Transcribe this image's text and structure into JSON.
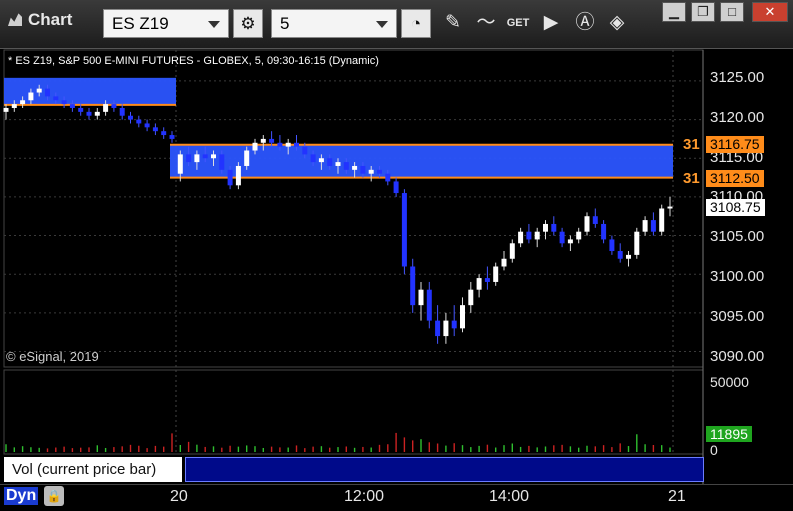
{
  "app": {
    "title": "Chart",
    "icon": "chart-icon"
  },
  "toolbar": {
    "symbol": "ES Z19",
    "interval": "5",
    "icons": [
      "settings-icon",
      "clock-icon",
      "pencil-draw-icon",
      "study-icon",
      "get-data-icon",
      "play-icon",
      "alert-icon",
      "fill-tool-icon"
    ],
    "get_label": "GET"
  },
  "window_controls": {
    "icons": [
      "minimize-icon",
      "restore-icon",
      "maximize-icon",
      "close-icon"
    ]
  },
  "chart": {
    "symbol_description": "* ES Z19, S&P 500 E-MINI FUTURES - GLOBEX, 5, 09:30-16:15 (Dynamic)",
    "copyright": "© eSignal, 2019",
    "price_ticks": [
      "3125.00",
      "3120.00",
      "3115.00",
      "3110.00",
      "3105.00",
      "3100.00",
      "3095.00",
      "3090.00"
    ],
    "level_upper": {
      "label": "31",
      "value": "3116.75",
      "color": "#ff8c1a"
    },
    "level_lower": {
      "label": "31",
      "value": "3112.50",
      "color": "#ff8c1a"
    },
    "last_price": "3108.75",
    "zone_color": "#2b55ff",
    "bull_color": "#ffffff",
    "bear_color": "#2233ff"
  },
  "volume": {
    "label": "Vol (current price bar)",
    "close": "×",
    "ticks": [
      "50000",
      "0"
    ],
    "last_value": "11895",
    "up_color": "#2fbf2f",
    "down_color": "#cc2222"
  },
  "footer": {
    "mode": "Dyn",
    "time_ticks": [
      "20",
      "12:00",
      "14:00",
      "21"
    ]
  },
  "chart_data": {
    "type": "candlestick",
    "ylim": [
      3088,
      3129
    ],
    "candles": [
      [
        3121,
        3122,
        3120,
        3121.5
      ],
      [
        3121.5,
        3122.5,
        3121,
        3122
      ],
      [
        3122,
        3123,
        3121.5,
        3122.5
      ],
      [
        3122.5,
        3124,
        3122,
        3123.5
      ],
      [
        3123.5,
        3124.5,
        3123,
        3124
      ],
      [
        3124,
        3124.5,
        3122.5,
        3123
      ],
      [
        3123,
        3123.5,
        3122,
        3122.5
      ],
      [
        3122.5,
        3123,
        3121.5,
        3122
      ],
      [
        3122,
        3122.5,
        3121,
        3121.5
      ],
      [
        3121.5,
        3122,
        3120.5,
        3121
      ],
      [
        3121,
        3121.5,
        3120,
        3120.5
      ],
      [
        3120.5,
        3121.5,
        3120,
        3121
      ],
      [
        3121,
        3122.5,
        3120.5,
        3122
      ],
      [
        3122,
        3122.5,
        3121,
        3121.5
      ],
      [
        3121.5,
        3122,
        3120,
        3120.5
      ],
      [
        3120.5,
        3121,
        3119.5,
        3120
      ],
      [
        3120,
        3120.5,
        3119,
        3119.5
      ],
      [
        3119.5,
        3120,
        3118.5,
        3119
      ],
      [
        3119,
        3119.5,
        3118,
        3118.5
      ],
      [
        3118.5,
        3119,
        3117.5,
        3118
      ],
      [
        3118,
        3118.5,
        3117,
        3117.5
      ],
      [
        3113,
        3116,
        3112,
        3115.5
      ],
      [
        3115.5,
        3116.5,
        3114,
        3114.5
      ],
      [
        3114.5,
        3116,
        3113.5,
        3115.5
      ],
      [
        3115.5,
        3116.5,
        3114.5,
        3115
      ],
      [
        3115,
        3116,
        3114,
        3115.5
      ],
      [
        3115.5,
        3116,
        3113,
        3113.5
      ],
      [
        3113.5,
        3114,
        3111,
        3111.5
      ],
      [
        3111.5,
        3114.5,
        3111,
        3114
      ],
      [
        3114,
        3116.5,
        3113.5,
        3116
      ],
      [
        3116,
        3117.5,
        3115.5,
        3117
      ],
      [
        3117,
        3118,
        3116,
        3117.5
      ],
      [
        3117.5,
        3118.5,
        3116.5,
        3117
      ],
      [
        3117,
        3118,
        3116,
        3116.5
      ],
      [
        3116.5,
        3117.5,
        3115.5,
        3117
      ],
      [
        3117,
        3118,
        3116,
        3116.5
      ],
      [
        3116.5,
        3117,
        3115,
        3115.5
      ],
      [
        3115.5,
        3116,
        3114,
        3114.5
      ],
      [
        3114.5,
        3115.5,
        3113.5,
        3115
      ],
      [
        3115,
        3115.5,
        3113.5,
        3114
      ],
      [
        3114,
        3115,
        3113,
        3114.5
      ],
      [
        3114.5,
        3115,
        3113,
        3113.5
      ],
      [
        3113.5,
        3114.5,
        3112.5,
        3114
      ],
      [
        3114,
        3114.5,
        3112.5,
        3113
      ],
      [
        3113,
        3114,
        3112,
        3113.5
      ],
      [
        3113.5,
        3114,
        3112.5,
        3113
      ],
      [
        3113,
        3113.5,
        3111.5,
        3112
      ],
      [
        3112,
        3112.5,
        3110,
        3110.5
      ],
      [
        3110.5,
        3111,
        3100,
        3101
      ],
      [
        3101,
        3102,
        3095,
        3096
      ],
      [
        3096,
        3099,
        3094,
        3098
      ],
      [
        3098,
        3099,
        3093,
        3094
      ],
      [
        3094,
        3096,
        3091,
        3092
      ],
      [
        3092,
        3095,
        3091,
        3094
      ],
      [
        3094,
        3096,
        3092,
        3093
      ],
      [
        3093,
        3097,
        3092.5,
        3096
      ],
      [
        3096,
        3099,
        3095,
        3098
      ],
      [
        3098,
        3100,
        3097,
        3099.5
      ],
      [
        3099.5,
        3101,
        3098,
        3099
      ],
      [
        3099,
        3101.5,
        3098.5,
        3101
      ],
      [
        3101,
        3103,
        3100.5,
        3102
      ],
      [
        3102,
        3104.5,
        3101.5,
        3104
      ],
      [
        3104,
        3106,
        3103.5,
        3105.5
      ],
      [
        3105.5,
        3106.5,
        3104,
        3104.5
      ],
      [
        3104.5,
        3106,
        3103.5,
        3105.5
      ],
      [
        3105.5,
        3107,
        3104.5,
        3106.5
      ],
      [
        3106.5,
        3107.5,
        3105,
        3105.5
      ],
      [
        3105.5,
        3106,
        3103.5,
        3104
      ],
      [
        3104,
        3105,
        3103,
        3104.5
      ],
      [
        3104.5,
        3106,
        3104,
        3105.5
      ],
      [
        3105.5,
        3108,
        3105,
        3107.5
      ],
      [
        3107.5,
        3108.5,
        3106,
        3106.5
      ],
      [
        3106.5,
        3107,
        3104,
        3104.5
      ],
      [
        3104.5,
        3105,
        3102.5,
        3103
      ],
      [
        3103,
        3104,
        3101.5,
        3102
      ],
      [
        3102,
        3103,
        3101,
        3102.5
      ],
      [
        3102.5,
        3106,
        3102,
        3105.5
      ],
      [
        3105.5,
        3107.5,
        3105,
        3107
      ],
      [
        3107,
        3108,
        3105,
        3105.5
      ],
      [
        3105.5,
        3109,
        3105,
        3108.5
      ],
      [
        3108.5,
        3110,
        3107.5,
        3108.75
      ]
    ],
    "volumes": [
      5200,
      3100,
      3900,
      3200,
      2800,
      2400,
      3000,
      3600,
      2600,
      2900,
      3100,
      4500,
      2700,
      3300,
      3800,
      4800,
      4200,
      2600,
      4100,
      3600,
      12500,
      4700,
      6800,
      4900,
      3400,
      3800,
      2900,
      4200,
      3600,
      4400,
      3900,
      2700,
      3600,
      3100,
      3000,
      4400,
      2600,
      3600,
      3900,
      2900,
      3300,
      3700,
      2800,
      3400,
      3000,
      4800,
      5200,
      12800,
      9800,
      7800,
      8600,
      6500,
      5700,
      4300,
      5900,
      4600,
      3300,
      4100,
      4900,
      3000,
      4600,
      5700,
      3400,
      4100,
      3100,
      3700,
      4500,
      4800,
      3800,
      2900,
      4200,
      3800,
      4600,
      3300,
      5800,
      4000,
      11895,
      5200,
      4700,
      4600,
      3000
    ],
    "ylim_volume": [
      0,
      55000
    ]
  }
}
